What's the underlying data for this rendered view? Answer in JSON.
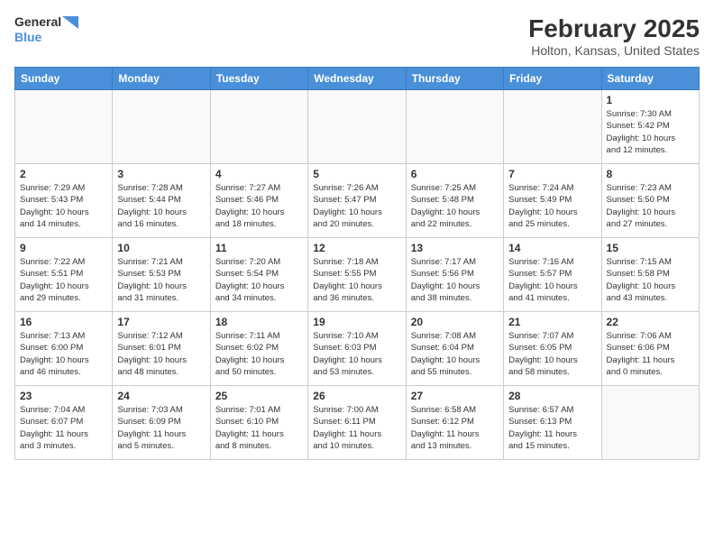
{
  "header": {
    "logo": {
      "line1": "General",
      "line2": "Blue"
    },
    "title": "February 2025",
    "location": "Holton, Kansas, United States"
  },
  "weekdays": [
    "Sunday",
    "Monday",
    "Tuesday",
    "Wednesday",
    "Thursday",
    "Friday",
    "Saturday"
  ],
  "weeks": [
    [
      {
        "day": "",
        "info": ""
      },
      {
        "day": "",
        "info": ""
      },
      {
        "day": "",
        "info": ""
      },
      {
        "day": "",
        "info": ""
      },
      {
        "day": "",
        "info": ""
      },
      {
        "day": "",
        "info": ""
      },
      {
        "day": "1",
        "info": "Sunrise: 7:30 AM\nSunset: 5:42 PM\nDaylight: 10 hours\nand 12 minutes."
      }
    ],
    [
      {
        "day": "2",
        "info": "Sunrise: 7:29 AM\nSunset: 5:43 PM\nDaylight: 10 hours\nand 14 minutes."
      },
      {
        "day": "3",
        "info": "Sunrise: 7:28 AM\nSunset: 5:44 PM\nDaylight: 10 hours\nand 16 minutes."
      },
      {
        "day": "4",
        "info": "Sunrise: 7:27 AM\nSunset: 5:46 PM\nDaylight: 10 hours\nand 18 minutes."
      },
      {
        "day": "5",
        "info": "Sunrise: 7:26 AM\nSunset: 5:47 PM\nDaylight: 10 hours\nand 20 minutes."
      },
      {
        "day": "6",
        "info": "Sunrise: 7:25 AM\nSunset: 5:48 PM\nDaylight: 10 hours\nand 22 minutes."
      },
      {
        "day": "7",
        "info": "Sunrise: 7:24 AM\nSunset: 5:49 PM\nDaylight: 10 hours\nand 25 minutes."
      },
      {
        "day": "8",
        "info": "Sunrise: 7:23 AM\nSunset: 5:50 PM\nDaylight: 10 hours\nand 27 minutes."
      }
    ],
    [
      {
        "day": "9",
        "info": "Sunrise: 7:22 AM\nSunset: 5:51 PM\nDaylight: 10 hours\nand 29 minutes."
      },
      {
        "day": "10",
        "info": "Sunrise: 7:21 AM\nSunset: 5:53 PM\nDaylight: 10 hours\nand 31 minutes."
      },
      {
        "day": "11",
        "info": "Sunrise: 7:20 AM\nSunset: 5:54 PM\nDaylight: 10 hours\nand 34 minutes."
      },
      {
        "day": "12",
        "info": "Sunrise: 7:18 AM\nSunset: 5:55 PM\nDaylight: 10 hours\nand 36 minutes."
      },
      {
        "day": "13",
        "info": "Sunrise: 7:17 AM\nSunset: 5:56 PM\nDaylight: 10 hours\nand 38 minutes."
      },
      {
        "day": "14",
        "info": "Sunrise: 7:16 AM\nSunset: 5:57 PM\nDaylight: 10 hours\nand 41 minutes."
      },
      {
        "day": "15",
        "info": "Sunrise: 7:15 AM\nSunset: 5:58 PM\nDaylight: 10 hours\nand 43 minutes."
      }
    ],
    [
      {
        "day": "16",
        "info": "Sunrise: 7:13 AM\nSunset: 6:00 PM\nDaylight: 10 hours\nand 46 minutes."
      },
      {
        "day": "17",
        "info": "Sunrise: 7:12 AM\nSunset: 6:01 PM\nDaylight: 10 hours\nand 48 minutes."
      },
      {
        "day": "18",
        "info": "Sunrise: 7:11 AM\nSunset: 6:02 PM\nDaylight: 10 hours\nand 50 minutes."
      },
      {
        "day": "19",
        "info": "Sunrise: 7:10 AM\nSunset: 6:03 PM\nDaylight: 10 hours\nand 53 minutes."
      },
      {
        "day": "20",
        "info": "Sunrise: 7:08 AM\nSunset: 6:04 PM\nDaylight: 10 hours\nand 55 minutes."
      },
      {
        "day": "21",
        "info": "Sunrise: 7:07 AM\nSunset: 6:05 PM\nDaylight: 10 hours\nand 58 minutes."
      },
      {
        "day": "22",
        "info": "Sunrise: 7:06 AM\nSunset: 6:06 PM\nDaylight: 11 hours\nand 0 minutes."
      }
    ],
    [
      {
        "day": "23",
        "info": "Sunrise: 7:04 AM\nSunset: 6:07 PM\nDaylight: 11 hours\nand 3 minutes."
      },
      {
        "day": "24",
        "info": "Sunrise: 7:03 AM\nSunset: 6:09 PM\nDaylight: 11 hours\nand 5 minutes."
      },
      {
        "day": "25",
        "info": "Sunrise: 7:01 AM\nSunset: 6:10 PM\nDaylight: 11 hours\nand 8 minutes."
      },
      {
        "day": "26",
        "info": "Sunrise: 7:00 AM\nSunset: 6:11 PM\nDaylight: 11 hours\nand 10 minutes."
      },
      {
        "day": "27",
        "info": "Sunrise: 6:58 AM\nSunset: 6:12 PM\nDaylight: 11 hours\nand 13 minutes."
      },
      {
        "day": "28",
        "info": "Sunrise: 6:57 AM\nSunset: 6:13 PM\nDaylight: 11 hours\nand 15 minutes."
      },
      {
        "day": "",
        "info": ""
      }
    ]
  ]
}
